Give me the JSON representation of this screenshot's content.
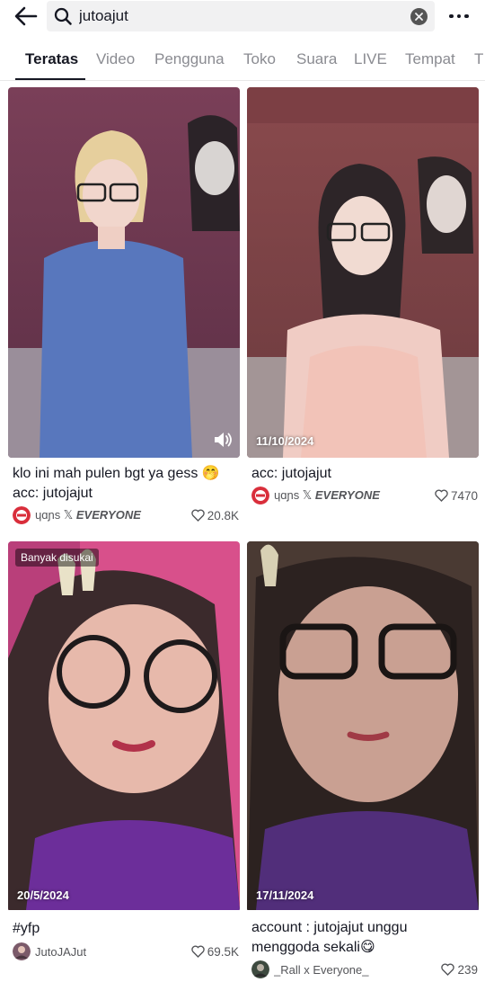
{
  "search": {
    "query": "jutoajut"
  },
  "tabs": [
    {
      "label": "Teratas"
    },
    {
      "label": "Video"
    },
    {
      "label": "Pengguna"
    },
    {
      "label": "Toko"
    },
    {
      "label": "Suara"
    },
    {
      "label": "LIVE"
    },
    {
      "label": "Tempat"
    },
    {
      "label": "T"
    }
  ],
  "results": [
    {
      "caption": "klo ini mah pulen bgt ya gess 🤭 acc: jutojajut",
      "author_prefix": "ɥɑɲs 𝕏 ",
      "author_emph": "EVERYONE",
      "likes": "20.8K",
      "date": "",
      "badge": "",
      "has_sound": true,
      "avatar_icon": "brand-logo-icon"
    },
    {
      "caption": "acc: jutojajut",
      "author_prefix": "ɥɑɲs 𝕏 ",
      "author_emph": "EVERYONE",
      "likes": "7470",
      "date": "11/10/2024",
      "badge": "",
      "has_sound": false,
      "avatar_icon": "brand-logo-icon"
    },
    {
      "caption": "#yfp",
      "author_prefix": "JutoJAJut",
      "author_emph": "",
      "likes": "69.5K",
      "date": "20/5/2024",
      "badge": "Banyak disukai",
      "has_sound": false,
      "avatar_icon": "user-avatar-icon"
    },
    {
      "caption": "account : jutojajut unggu menggoda sekali😋",
      "author_prefix": "_Rall x Everyone_",
      "author_emph": "",
      "likes": "239",
      "date": "17/11/2024",
      "badge": "",
      "has_sound": false,
      "avatar_icon": "user-avatar-icon"
    }
  ],
  "colors": {
    "accent_text": "#161823",
    "muted_text": "#8a8b91",
    "search_bg": "#f1f1f2"
  }
}
